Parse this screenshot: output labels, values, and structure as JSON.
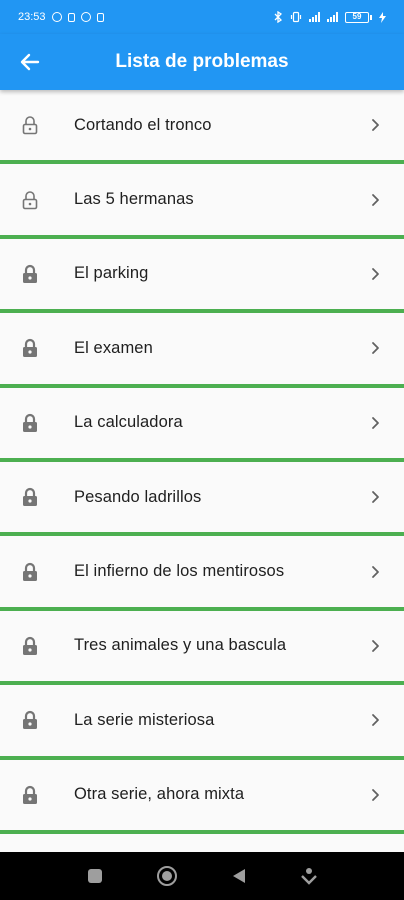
{
  "status_bar": {
    "time": "23:53",
    "battery": "59"
  },
  "app_bar": {
    "title": "Lista de problemas",
    "back_icon": "arrow-left-icon"
  },
  "problems": [
    {
      "label": "Cortando el tronco",
      "lock": "unlocked"
    },
    {
      "label": "Las 5 hermanas",
      "lock": "unlocked"
    },
    {
      "label": "El parking",
      "lock": "locked"
    },
    {
      "label": "El examen",
      "lock": "locked"
    },
    {
      "label": "La calculadora",
      "lock": "locked"
    },
    {
      "label": "Pesando ladrillos",
      "lock": "locked"
    },
    {
      "label": "El infierno de los mentirosos",
      "lock": "locked"
    },
    {
      "label": "Tres animales y una bascula",
      "lock": "locked"
    },
    {
      "label": "La serie misteriosa",
      "lock": "locked"
    },
    {
      "label": "Otra serie, ahora mixta",
      "lock": "locked"
    }
  ],
  "colors": {
    "primary": "#2196f3",
    "divider": "#4caf50",
    "icon": "#757575"
  },
  "nav_bar": {
    "buttons": [
      "recents-icon",
      "home-icon",
      "back-icon",
      "assistant-icon"
    ]
  }
}
